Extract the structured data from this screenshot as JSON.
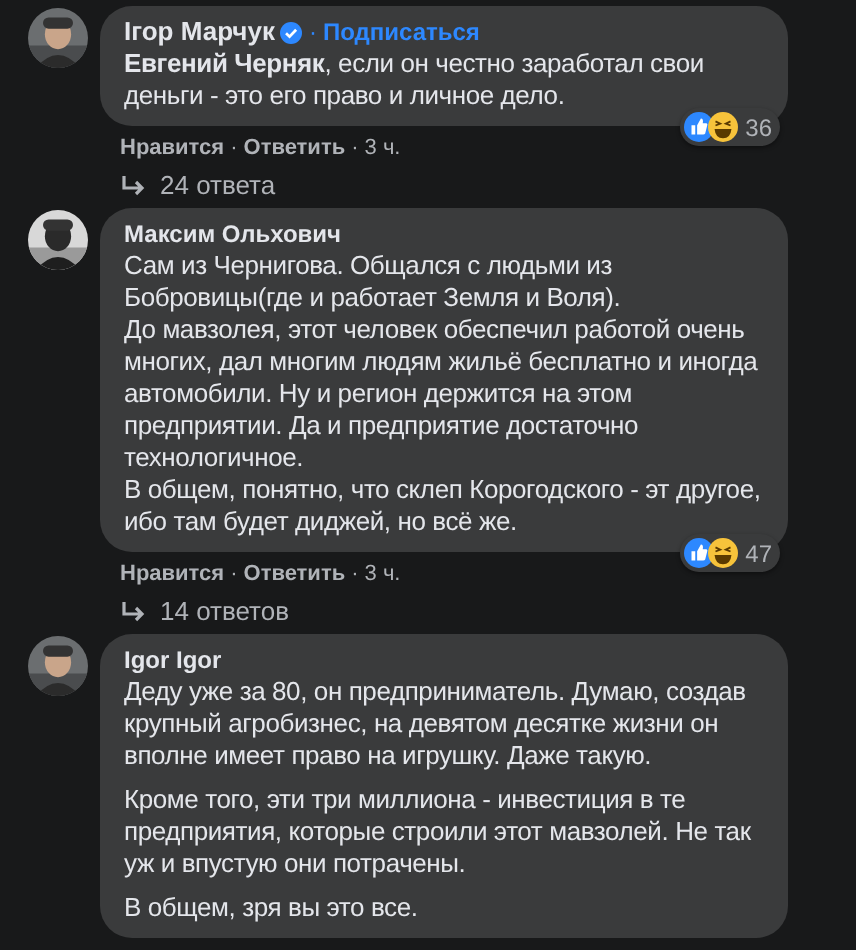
{
  "separator": "·",
  "comments": [
    {
      "author": "Ігор Марчук",
      "verified": true,
      "follow": "Подписаться",
      "paragraph_gap": false,
      "paragraphs": [
        "**Евгений Черняк**, если он честно заработал свои деньги - это его право и личное дело."
      ],
      "reactions": {
        "count": "36"
      },
      "actions": [
        {
          "label": "Нравится",
          "kind": "link"
        },
        {
          "label": "Ответить",
          "kind": "link"
        },
        {
          "label": "3 ч.",
          "kind": "time"
        }
      ],
      "replies": "24 ответа"
    },
    {
      "author": "Максим Ольхович",
      "paragraph_gap": false,
      "paragraphs": [
        "Сам из Чернигова. Общался с людьми из Бобровицы(где и работает Земля и Воля).",
        "До мавзолея, этот человек обеспечил работой очень многих, дал многим людям жильё бесплатно и иногда автомобили. Ну и регион держится на этом предприятии. Да и предприятие достаточно технологичное.",
        "В общем, понятно, что склеп Корогодского - эт другое, ибо там будет диджей, но всё же."
      ],
      "reactions": {
        "count": "47"
      },
      "actions": [
        {
          "label": "Нравится",
          "kind": "link"
        },
        {
          "label": "Ответить",
          "kind": "link"
        },
        {
          "label": "3 ч.",
          "kind": "time"
        }
      ],
      "replies": "14 ответов"
    },
    {
      "author": "Igor Igor",
      "paragraph_gap": true,
      "paragraphs": [
        "Деду уже за 80, он предприниматель. Думаю, создав крупный агробизнес, на девятом десятке жизни он вполне имеет право на игрушку. Даже такую.",
        "Кроме того, эти три миллиона - инвестиция в те предприятия, которые строили этот мавзолей. Не так уж и впустую они потрачены.",
        "В общем, зря вы это все."
      ]
    }
  ]
}
